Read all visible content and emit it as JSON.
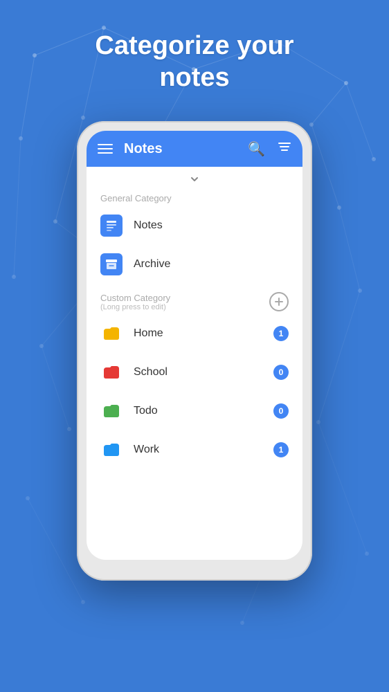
{
  "hero": {
    "title": "Categorize your\nnotes"
  },
  "appBar": {
    "title": "Notes",
    "menuIcon": "menu-icon",
    "searchIcon": "search-icon",
    "filterIcon": "filter-icon"
  },
  "generalSection": {
    "label": "General Category",
    "items": [
      {
        "id": "notes",
        "icon": "notes-icon",
        "label": "Notes"
      },
      {
        "id": "archive",
        "icon": "archive-icon",
        "label": "Archive"
      }
    ]
  },
  "customSection": {
    "title": "Custom Category",
    "subtitle": "(Long press to edit)",
    "addButtonLabel": "+",
    "items": [
      {
        "id": "home",
        "label": "Home",
        "colorClass": "folder-home",
        "badge": "1"
      },
      {
        "id": "school",
        "label": "School",
        "colorClass": "folder-school",
        "badge": "0"
      },
      {
        "id": "todo",
        "label": "Todo",
        "colorClass": "folder-todo",
        "badge": "0"
      },
      {
        "id": "work",
        "label": "Work",
        "colorClass": "folder-work",
        "badge": "1"
      }
    ]
  },
  "colors": {
    "appBarBg": "#4285f4",
    "heroBg": "#3a7bd5",
    "badgeBg": "#4285f4"
  }
}
